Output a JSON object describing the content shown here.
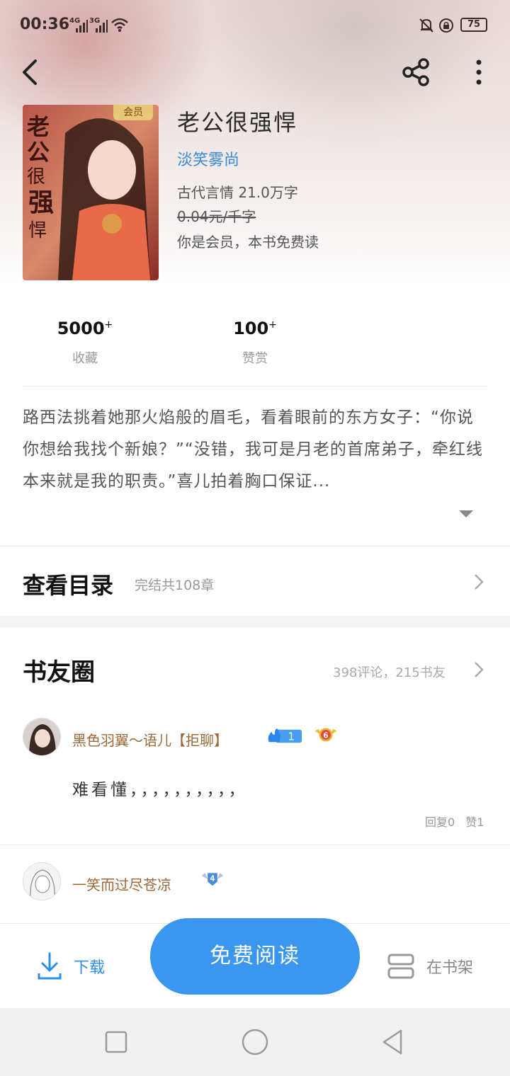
{
  "status_bar": {
    "time": "00:36",
    "signal_1": "4G",
    "signal_2": "3G",
    "battery": "75"
  },
  "book": {
    "title": "老公很强悍",
    "author": "淡笑雾尚",
    "category_wordcount": "古代言情  21.0万字",
    "price": "0.04元/千字",
    "vip_note": "你是会员，本书免费读",
    "vip_tag": "会员"
  },
  "stats": [
    {
      "value": "5000",
      "suffix": "+",
      "label": "收藏"
    },
    {
      "value": "100",
      "suffix": "+",
      "label": "赞赏"
    }
  ],
  "description": "路西法挑着她那火焰般的眉毛，看着眼前的东方女子：“你说你想给我找个新娘？”“没错，我可是月老的首席弟子，牵红线本来就是我的职责。”喜儿拍着胸口保证...",
  "toc": {
    "title": "查看目录",
    "subtitle": "完结共108章"
  },
  "circle": {
    "title": "书友圈",
    "stats": "398评论，215书友"
  },
  "comments": [
    {
      "username": "黑色羽翼～语儿【拒聊】",
      "fire_level": "1",
      "badge_level": "6",
      "text": "难看懂，，，，，，，，，，",
      "reply": "回复0",
      "like": "赞1"
    },
    {
      "username": "一笑而过尽苍凉",
      "badge_level": "4"
    }
  ],
  "bottom_bar": {
    "download": "下载",
    "read": "免费阅读",
    "shelf": "在书架"
  },
  "colors": {
    "accent": "#3a96ee",
    "author": "#3a8ad8",
    "username": "#9a6a3a"
  }
}
